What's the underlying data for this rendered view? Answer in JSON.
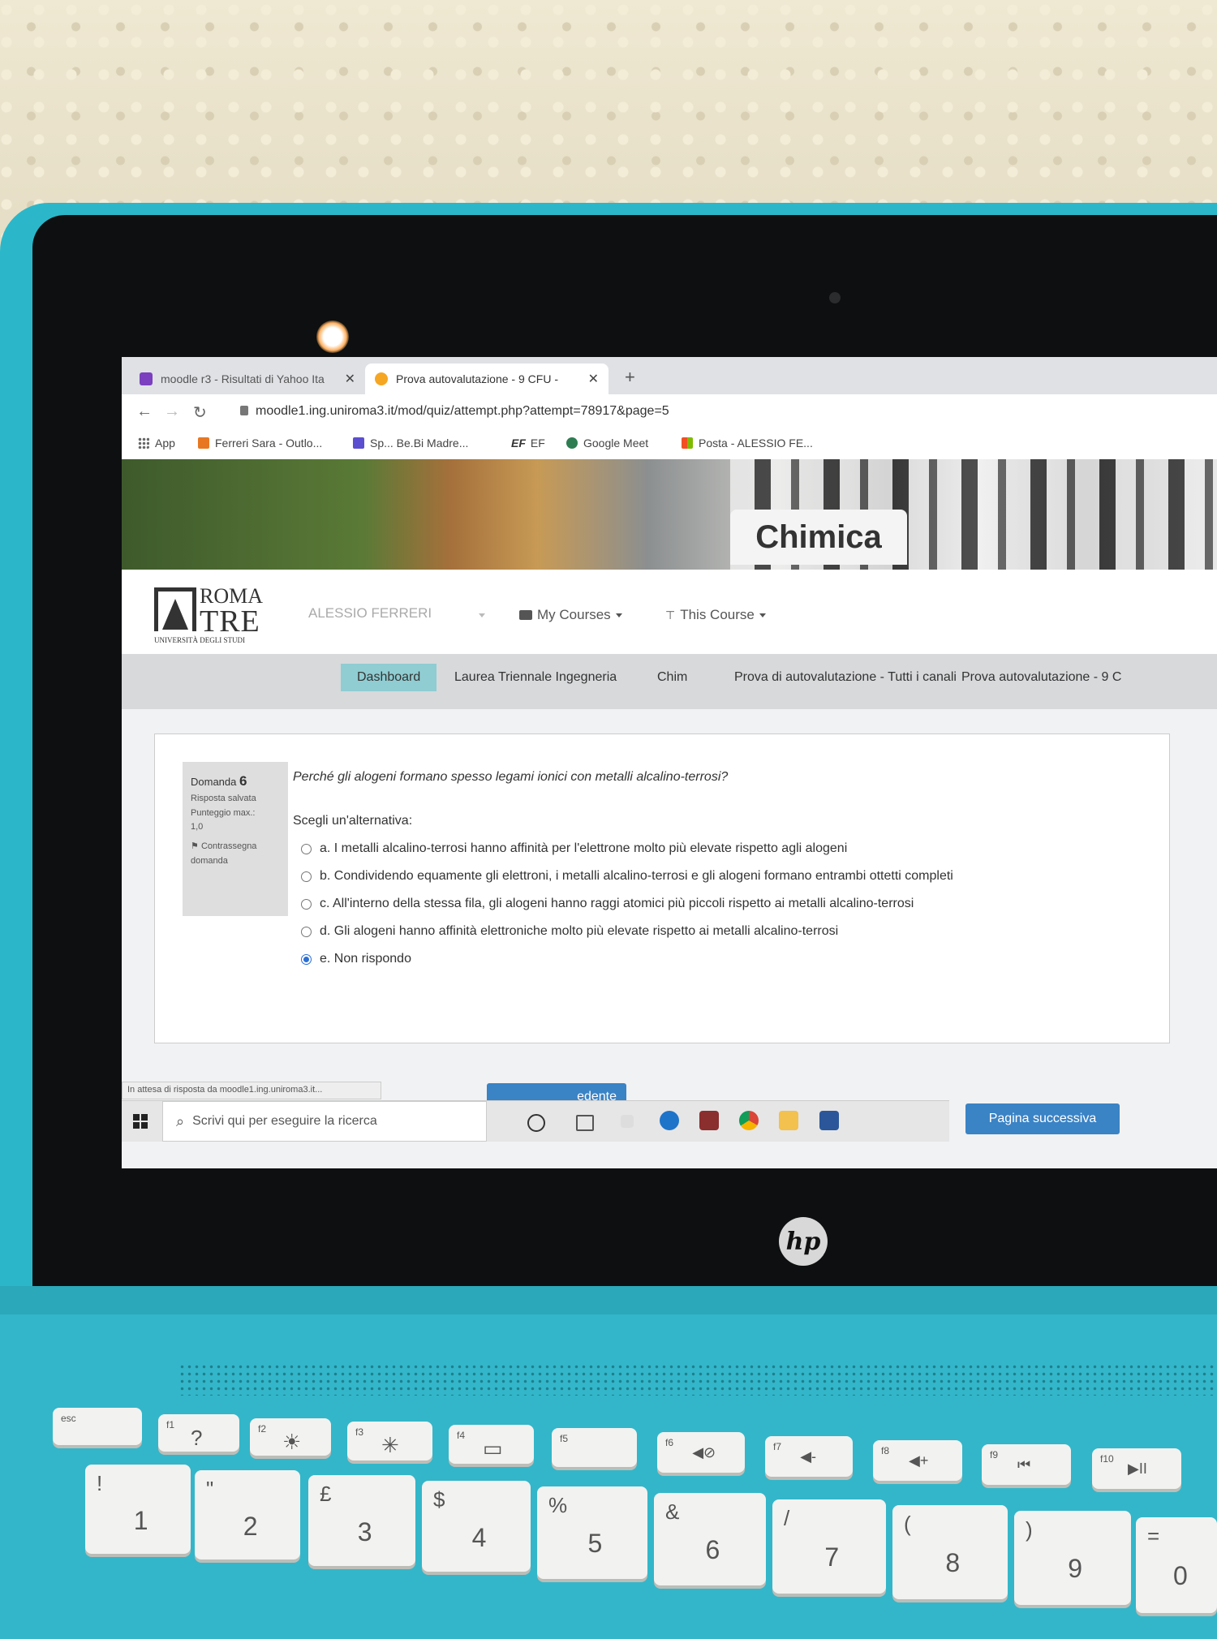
{
  "browser": {
    "tabs": [
      {
        "label": "moodle r3 - Risultati di Yahoo Ita",
        "close": "✕"
      },
      {
        "label": "Prova autovalutazione - 9 CFU - ",
        "close": "✕"
      }
    ],
    "new_tab": "+",
    "url": "moodle1.ing.uniroma3.it/mod/quiz/attempt.php?attempt=78917&page=5",
    "bookmarks": [
      "App",
      "Ferreri Sara - Outlo...",
      "Sp... Be.Bi Madre...",
      "EF",
      "Google Meet",
      "Posta - ALESSIO FE..."
    ]
  },
  "banner": {
    "course_title": "Chimica"
  },
  "navbar": {
    "logo": {
      "line1": "ROMA",
      "line2": "TRE",
      "line3": "UNIVERSITÀ DEGLI STUDI"
    },
    "user": "ALESSIO FERRERI",
    "my_courses": "My Courses",
    "this_course": "This Course"
  },
  "breadcrumb": [
    "Dashboard",
    "Laurea Triennale Ingegneria",
    "Chim",
    "Prova di autovalutazione - Tutti i canali",
    "Prova autovalutazione - 9 C"
  ],
  "question": {
    "label": "Domanda",
    "number": "6",
    "status": "Risposta salvata",
    "max_score_label": "Punteggio max.:",
    "max_score": "1,0",
    "flag_label": "Contrassegna domanda",
    "text": "Perché gli alogeni formano spesso legami ionici con metalli alcalino-terrosi?",
    "choose": "Scegli un'alternativa:",
    "answers": [
      {
        "text": "a. I metalli alcalino-terrosi hanno affinità per l'elettrone molto più elevate rispetto agli alogeni",
        "selected": false
      },
      {
        "text": "b. Condividendo equamente gli elettroni, i metalli alcalino-terrosi e gli alogeni formano entrambi ottetti completi",
        "selected": false
      },
      {
        "text": "c. All'interno della stessa fila, gli alogeni hanno raggi atomici più piccoli rispetto ai metalli alcalino-terrosi",
        "selected": false
      },
      {
        "text": "d. Gli alogeni hanno affinità elettroniche molto più elevate rispetto ai metalli alcalino-terrosi",
        "selected": false
      },
      {
        "text": "e. Non rispondo",
        "selected": true
      }
    ]
  },
  "status_text": "In attesa di risposta da moodle1.ing.uniroma3.it...",
  "buttons": {
    "previous": "edente",
    "next": "Pagina successiva"
  },
  "taskbar": {
    "search_placeholder": "Scrivi qui per eseguire la ricerca"
  },
  "device": {
    "brand": "hp"
  },
  "keyboard": {
    "fkeys": [
      {
        "fn": "",
        "label": "esc"
      },
      {
        "fn": "f1",
        "label": "?"
      },
      {
        "fn": "f2",
        "label": "☀"
      },
      {
        "fn": "f3",
        "label": "✳"
      },
      {
        "fn": "f4",
        "label": "▭"
      },
      {
        "fn": "f5",
        "label": ""
      },
      {
        "fn": "f6",
        "label": "◀⊘"
      },
      {
        "fn": "f7",
        "label": "◀-"
      },
      {
        "fn": "f8",
        "label": "◀+"
      },
      {
        "fn": "f9",
        "label": "⏮"
      },
      {
        "fn": "f10",
        "label": "▶II"
      }
    ],
    "number_row": [
      {
        "sym": "!",
        "num": "1"
      },
      {
        "sym": "\"",
        "num": "2"
      },
      {
        "sym": "£",
        "num": "3"
      },
      {
        "sym": "$",
        "num": "4"
      },
      {
        "sym": "%",
        "num": "5"
      },
      {
        "sym": "&",
        "num": "6"
      },
      {
        "sym": "/",
        "num": "7"
      },
      {
        "sym": "(",
        "num": "8"
      },
      {
        "sym": ")",
        "num": "9"
      },
      {
        "sym": "=",
        "num": "0"
      }
    ]
  },
  "colors": {
    "accent": "#3a83c5",
    "breadcrumb_active": "#8fcdd2",
    "laptop": "#2bb7c9"
  }
}
